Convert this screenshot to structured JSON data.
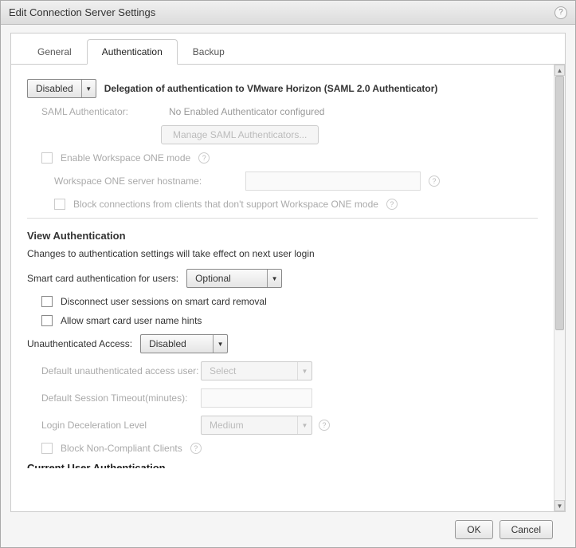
{
  "dialog": {
    "title": "Edit Connection Server Settings"
  },
  "tabs": {
    "general": "General",
    "authentication": "Authentication",
    "backup": "Backup"
  },
  "saml": {
    "dropdown_value": "Disabled",
    "heading": "Delegation of authentication to VMware Horizon (SAML 2.0 Authenticator)",
    "authenticator_label": "SAML Authenticator:",
    "authenticator_value": "No Enabled Authenticator configured",
    "manage_button": "Manage SAML Authenticators...",
    "enable_ws1": "Enable Workspace ONE mode",
    "ws1_hostname_label": "Workspace ONE server hostname:",
    "block_ws1": "Block connections from clients that don't support Workspace ONE mode"
  },
  "view_auth": {
    "title": "View Authentication",
    "notice": "Changes to authentication settings will take effect on next user login",
    "smartcard_label": "Smart card authentication for users:",
    "smartcard_value": "Optional",
    "disconnect_on_removal": "Disconnect user sessions on smart card removal",
    "allow_hints": "Allow smart card user name hints",
    "unauth_label": "Unauthenticated Access:",
    "unauth_value": "Disabled",
    "default_user_label": "Default unauthenticated access user:",
    "default_user_value": "Select",
    "session_timeout_label": "Default Session Timeout(minutes):",
    "decel_label": "Login Deceleration Level",
    "decel_value": "Medium",
    "block_noncompliant": "Block Non-Compliant Clients",
    "cutoff_title": "Current User Authentication"
  },
  "footer": {
    "ok": "OK",
    "cancel": "Cancel"
  }
}
